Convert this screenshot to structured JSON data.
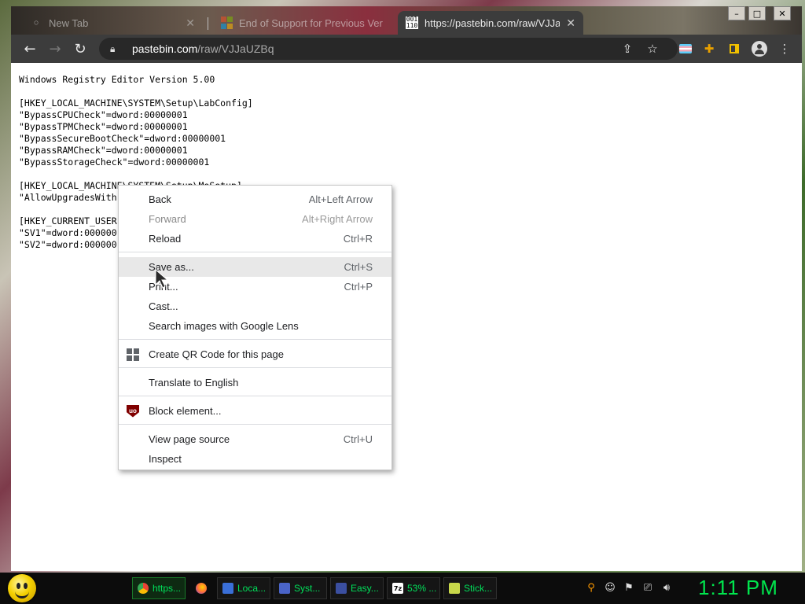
{
  "tabs": [
    {
      "title": "New Tab",
      "active": false
    },
    {
      "title": "End of Support for Previous Ver",
      "active": false
    },
    {
      "title": "https://pastebin.com/raw/VJJaUZ",
      "active": true,
      "favicon_text": "001\n110"
    }
  ],
  "window_controls": {
    "minimize": "–",
    "maximize": "□",
    "close": "✕"
  },
  "toolbar": {
    "url_host": "pastebin.com",
    "url_path": "/raw/VJJaUZBq",
    "icons": [
      "back-icon",
      "forward-icon",
      "reload-icon",
      "lock-icon",
      "share-icon",
      "bookmark-star-icon",
      "extension-flag-icon",
      "puzzle-icon",
      "sidepanel-icon",
      "profile-icon",
      "menu-icon"
    ]
  },
  "page_text": "Windows Registry Editor Version 5.00\n\n[HKEY_LOCAL_MACHINE\\SYSTEM\\Setup\\LabConfig]\n\"BypassCPUCheck\"=dword:00000001\n\"BypassTPMCheck\"=dword:00000001\n\"BypassSecureBootCheck\"=dword:00000001\n\"BypassRAMCheck\"=dword:00000001\n\"BypassStorageCheck\"=dword:00000001\n\n[HKEY_LOCAL_MACHINE\\SYSTEM\\Setup\\MoSetup]\n\"AllowUpgradesWith\n\n[HKEY_CURRENT_USER                                    che]\n\"SV1\"=dword:000000\n\"SV2\"=dword:000000",
  "context_menu": {
    "groups": [
      [
        {
          "label": "Back",
          "shortcut": "Alt+Left Arrow",
          "enabled": true
        },
        {
          "label": "Forward",
          "shortcut": "Alt+Right Arrow",
          "enabled": false
        },
        {
          "label": "Reload",
          "shortcut": "Ctrl+R",
          "enabled": true
        }
      ],
      [
        {
          "label": "Save as...",
          "shortcut": "Ctrl+S",
          "enabled": true,
          "hovered": true
        },
        {
          "label": "Print...",
          "shortcut": "Ctrl+P",
          "enabled": true
        },
        {
          "label": "Cast...",
          "shortcut": "",
          "enabled": true
        },
        {
          "label": "Search images with Google Lens",
          "shortcut": "",
          "enabled": true
        }
      ],
      [
        {
          "label": "Create QR Code for this page",
          "shortcut": "",
          "enabled": true,
          "icon": "qr-code-icon"
        }
      ],
      [
        {
          "label": "Translate to English",
          "shortcut": "",
          "enabled": true
        }
      ],
      [
        {
          "label": "Block element...",
          "shortcut": "",
          "enabled": true,
          "icon": "ublock-icon",
          "icon_text": "uo"
        }
      ],
      [
        {
          "label": "View page source",
          "shortcut": "Ctrl+U",
          "enabled": true
        },
        {
          "label": "Inspect",
          "shortcut": "",
          "enabled": true
        }
      ]
    ]
  },
  "taskbar": {
    "items": [
      {
        "label": "https...",
        "icon": "chrome-icon",
        "active": true,
        "color": "#4285f4"
      },
      {
        "label": "",
        "icon": "firefox-icon",
        "active": false,
        "color": "#ff7139"
      },
      {
        "label": "Loca...",
        "icon": "local-disk-icon",
        "active": false,
        "color": "#3a6fd8"
      },
      {
        "label": "Syst...",
        "icon": "system-icon",
        "active": false,
        "color": "#4a64c8"
      },
      {
        "label": "Easy...",
        "icon": "easy-icon",
        "active": false,
        "color": "#3b4fa0"
      },
      {
        "label": "53% ...",
        "icon": "7zip-icon",
        "active": false,
        "color": "#222222",
        "icon_text": "7z"
      },
      {
        "label": "Stick...",
        "icon": "sticky-notes-icon",
        "active": false,
        "color": "#c8d84a"
      }
    ],
    "tray": [
      "search-tray-icon",
      "emoji-tray-icon",
      "flag-tray-icon",
      "network-tray-icon",
      "volume-tray-icon"
    ],
    "clock": "1:11 PM"
  }
}
